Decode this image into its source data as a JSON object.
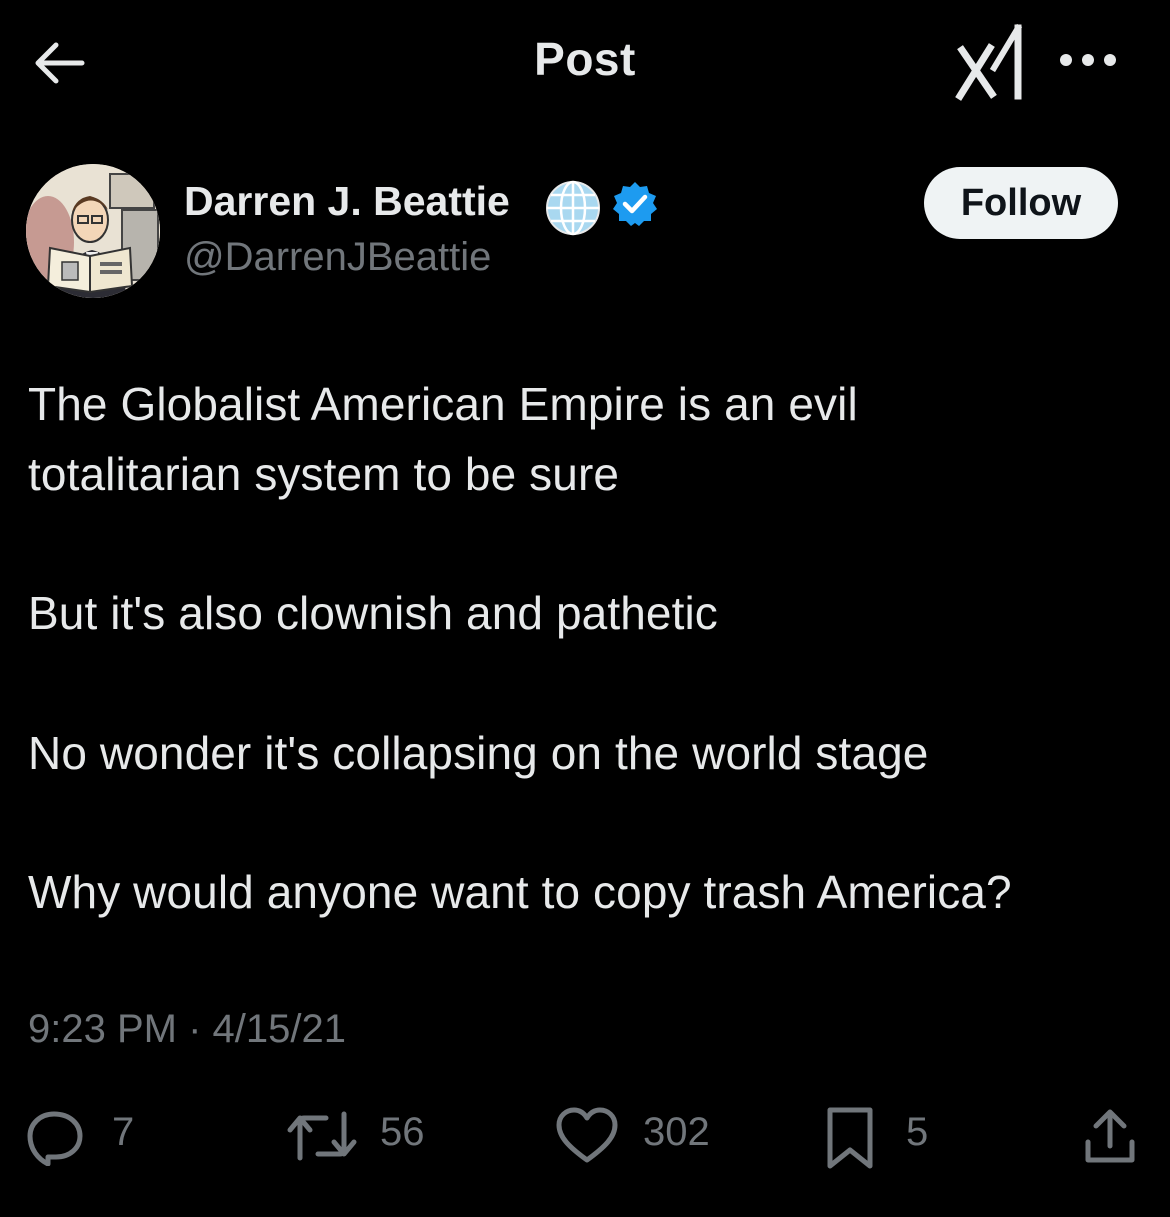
{
  "header": {
    "title": "Post",
    "back_icon": "arrow-left-icon",
    "grok_icon": "grok-logo-icon",
    "more_icon": "more-horizontal-icon"
  },
  "author": {
    "name": "Darren J. Beattie",
    "handle": "@DarrenJBeattie",
    "affiliation_icon": "globe-icon",
    "verified_icon": "verified-badge-icon",
    "verified_color": "#1d9bf0",
    "follow_label": "Follow"
  },
  "post": {
    "lines": [
      "The Globalist American Empire is an evil",
      "totalitarian system to be sure",
      "But it's also clownish and pathetic",
      "No wonder it's collapsing on the world stage",
      "Why would anyone want to copy trash America?"
    ],
    "timestamp": "9:23 PM · 4/15/21"
  },
  "actions": {
    "replies": "7",
    "reposts": "56",
    "likes": "302",
    "bookmarks": "5",
    "share_icon": "share-icon"
  },
  "colors": {
    "background": "#000000",
    "primary_text": "#e7e9ea",
    "secondary_text": "#71767b",
    "follow_button_bg": "#eff3f4"
  }
}
